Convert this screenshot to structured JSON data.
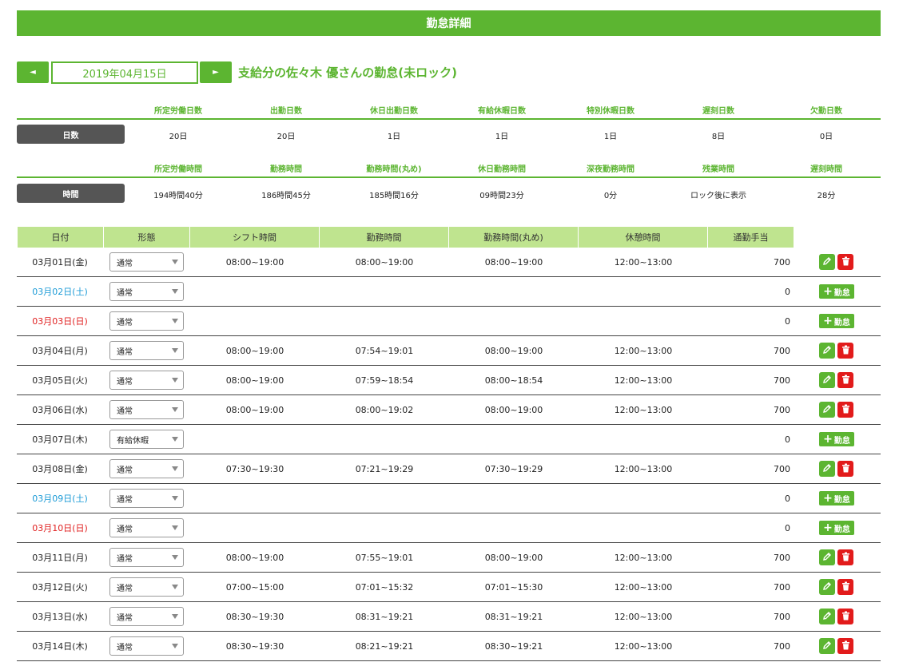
{
  "header": {
    "title": "勤怠詳細"
  },
  "nav": {
    "prev_label": "◄",
    "next_label": "►",
    "date": "2019年04月15日",
    "heading": "支給分の佐々木 優さんの勤怠(未ロック)"
  },
  "days_summary": {
    "label": "日数",
    "columns": [
      "所定労働日数",
      "出勤日数",
      "休日出勤日数",
      "有給休暇日数",
      "特別休暇日数",
      "遅刻日数",
      "欠勤日数"
    ],
    "values": [
      "20日",
      "20日",
      "1日",
      "1日",
      "1日",
      "8日",
      "0日"
    ]
  },
  "time_summary": {
    "label": "時間",
    "columns": [
      "所定労働時間",
      "勤務時間",
      "勤務時間(丸め)",
      "休日勤務時間",
      "深夜勤務時間",
      "残業時間",
      "遅刻時間"
    ],
    "values": [
      "194時間40分",
      "186時間45分",
      "185時間16分",
      "09時間23分",
      "0分",
      "ロック後に表示",
      "28分"
    ]
  },
  "table": {
    "headers": [
      "日付",
      "形態",
      "シフト時間",
      "勤務時間",
      "勤務時間(丸め)",
      "休憩時間",
      "通勤手当"
    ],
    "add_label": "勤怠",
    "rows": [
      {
        "date": "03月01日(金)",
        "day": "weekday",
        "type": "通常",
        "shift": "08:00~19:00",
        "work": "08:00~19:00",
        "work_round": "08:00~19:00",
        "rest": "12:00~13:00",
        "pay": "700",
        "action": "edit"
      },
      {
        "date": "03月02日(土)",
        "day": "sat",
        "type": "通常",
        "shift": "",
        "work": "",
        "work_round": "",
        "rest": "",
        "pay": "0",
        "action": "add"
      },
      {
        "date": "03月03日(日)",
        "day": "sun",
        "type": "通常",
        "shift": "",
        "work": "",
        "work_round": "",
        "rest": "",
        "pay": "0",
        "action": "add"
      },
      {
        "date": "03月04日(月)",
        "day": "weekday",
        "type": "通常",
        "shift": "08:00~19:00",
        "work": "07:54~19:01",
        "work_round": "08:00~19:00",
        "rest": "12:00~13:00",
        "pay": "700",
        "action": "edit"
      },
      {
        "date": "03月05日(火)",
        "day": "weekday",
        "type": "通常",
        "shift": "08:00~19:00",
        "work": "07:59~18:54",
        "work_round": "08:00~18:54",
        "rest": "12:00~13:00",
        "pay": "700",
        "action": "edit"
      },
      {
        "date": "03月06日(水)",
        "day": "weekday",
        "type": "通常",
        "shift": "08:00~19:00",
        "work": "08:00~19:02",
        "work_round": "08:00~19:00",
        "rest": "12:00~13:00",
        "pay": "700",
        "action": "edit"
      },
      {
        "date": "03月07日(木)",
        "day": "weekday",
        "type": "有給休暇",
        "shift": "",
        "work": "",
        "work_round": "",
        "rest": "",
        "pay": "0",
        "action": "add"
      },
      {
        "date": "03月08日(金)",
        "day": "weekday",
        "type": "通常",
        "shift": "07:30~19:30",
        "work": "07:21~19:29",
        "work_round": "07:30~19:29",
        "rest": "12:00~13:00",
        "pay": "700",
        "action": "edit"
      },
      {
        "date": "03月09日(土)",
        "day": "sat",
        "type": "通常",
        "shift": "",
        "work": "",
        "work_round": "",
        "rest": "",
        "pay": "0",
        "action": "add"
      },
      {
        "date": "03月10日(日)",
        "day": "sun",
        "type": "通常",
        "shift": "",
        "work": "",
        "work_round": "",
        "rest": "",
        "pay": "0",
        "action": "add"
      },
      {
        "date": "03月11日(月)",
        "day": "weekday",
        "type": "通常",
        "shift": "08:00~19:00",
        "work": "07:55~19:01",
        "work_round": "08:00~19:00",
        "rest": "12:00~13:00",
        "pay": "700",
        "action": "edit"
      },
      {
        "date": "03月12日(火)",
        "day": "weekday",
        "type": "通常",
        "shift": "07:00~15:00",
        "work": "07:01~15:32",
        "work_round": "07:01~15:30",
        "rest": "12:00~13:00",
        "pay": "700",
        "action": "edit"
      },
      {
        "date": "03月13日(水)",
        "day": "weekday",
        "type": "通常",
        "shift": "08:30~19:30",
        "work": "08:31~19:21",
        "work_round": "08:31~19:21",
        "rest": "12:00~13:00",
        "pay": "700",
        "action": "edit"
      },
      {
        "date": "03月14日(木)",
        "day": "weekday",
        "type": "通常",
        "shift": "08:30~19:30",
        "work": "08:21~19:21",
        "work_round": "08:30~19:21",
        "rest": "12:00~13:00",
        "pay": "700",
        "action": "edit"
      }
    ]
  },
  "colors": {
    "accent": "#5cb531",
    "header_cell": "#bfe48f",
    "saturday": "#1a9ad6",
    "sunday": "#e02020",
    "delete": "#e21b1b"
  },
  "icons": {
    "edit": "pencil-icon",
    "delete": "trash-icon",
    "add": "plus-icon"
  }
}
